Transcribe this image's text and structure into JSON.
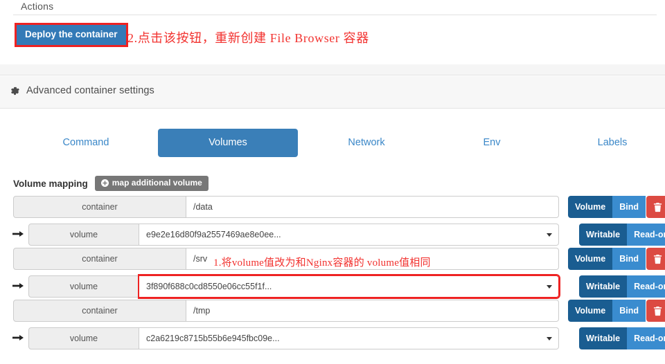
{
  "actions": {
    "title": "Actions",
    "deploy_label": "Deploy the container"
  },
  "annotations": {
    "step2": "2.点击该按钮，重新创建 File Browser 容器",
    "step1": "1.将volume值改为和Nginx容器的 volume值相同",
    "accent_color": "#f2322f"
  },
  "advanced": {
    "label": "Advanced container settings",
    "icon": "gear-icon"
  },
  "tabs": [
    {
      "label": "Command",
      "active": false
    },
    {
      "label": "Volumes",
      "active": true
    },
    {
      "label": "Network",
      "active": false
    },
    {
      "label": "Env",
      "active": false
    },
    {
      "label": "Labels",
      "active": false
    }
  ],
  "volume_mapping": {
    "title": "Volume mapping",
    "add_button": "map additional volume",
    "add_icon": "plus-circle-icon",
    "type_buttons": {
      "volume": "Volume",
      "bind": "Bind"
    },
    "access_buttons": {
      "writable": "Writable",
      "readonly": "Read-only"
    },
    "delete_icon": "trash-icon",
    "arrow_icon": "arrow-right-icon",
    "rows": [
      {
        "container_label": "container",
        "container_path": "/data",
        "volume_label": "volume",
        "volume_value": "e9e2e16d80f9a2557469ae8e0ee...",
        "type_selected": "volume",
        "access_selected": "writable",
        "highlighted": false
      },
      {
        "container_label": "container",
        "container_path": "/srv",
        "volume_label": "volume",
        "volume_value": "3f890f688c0cd8550e06cc55f1f...",
        "type_selected": "volume",
        "access_selected": "writable",
        "highlighted": true
      },
      {
        "container_label": "container",
        "container_path": "/tmp",
        "volume_label": "volume",
        "volume_value": "c2a6219c8715b55b6e945fbc09e...",
        "type_selected": "volume",
        "access_selected": "writable",
        "highlighted": false
      }
    ]
  },
  "colors": {
    "primary": "#337ab7",
    "tab_active": "#3a7fb8",
    "btn_dark": "#1a5d91",
    "btn_light": "#3a8ccf",
    "danger": "#dc4a42",
    "addon_bg": "#eeeeee"
  }
}
